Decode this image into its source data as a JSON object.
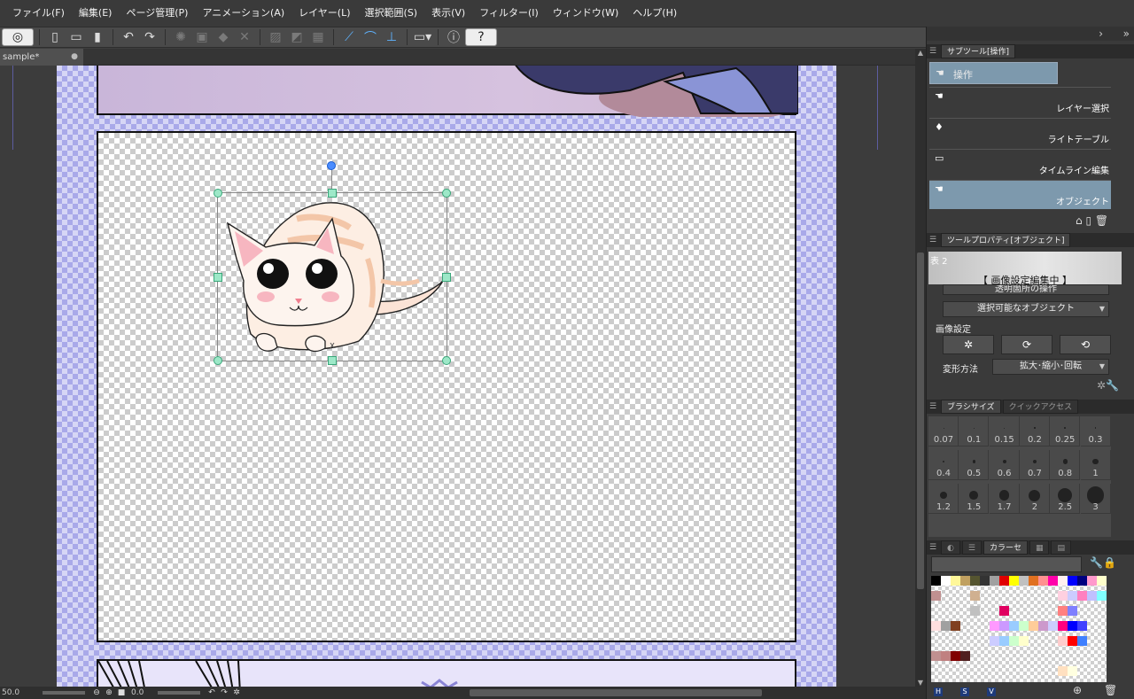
{
  "menu": [
    "ファイル(F)",
    "編集(E)",
    "ページ管理(P)",
    "アニメーション(A)",
    "レイヤー(L)",
    "選択範囲(S)",
    "表示(V)",
    "フィルター(I)",
    "ウィンドウ(W)",
    "ヘルプ(H)"
  ],
  "document": {
    "tab_title": "sample*"
  },
  "status": {
    "zoom": "50.0",
    "angle": "0.0"
  },
  "subtool_panel": {
    "title": "サブツール[操作]",
    "group_label": "操作",
    "items": [
      {
        "label": "レイヤー選択"
      },
      {
        "label": "ライトテーブル"
      },
      {
        "label": "タイムライン編集"
      },
      {
        "label": "オブジェクト"
      }
    ]
  },
  "tool_property_panel": {
    "title": "ツールプロパティ[オブジェクト]",
    "preview_name": "表 2",
    "preview_status": "【 画像設定編集中 】",
    "transparent_op": "透明箇所の操作",
    "selectable_object": "選択可能なオブジェクト",
    "image_settings_label": "画像設定",
    "transform_label": "変形方法",
    "transform_value": "拡大･縮小･回転"
  },
  "brush_panel": {
    "tabs": [
      "ブラシサイズ",
      "クイックアクセス"
    ],
    "sizes": [
      "0.07",
      "0.1",
      "0.15",
      "0.2",
      "0.25",
      "0.3",
      "0.4",
      "0.5",
      "0.6",
      "0.7",
      "0.8",
      "1",
      "1.2",
      "1.5",
      "1.7",
      "2",
      "2.5",
      "3"
    ]
  },
  "color_panel": {
    "tab_label": "カラーセ",
    "footer": [
      "H",
      "S",
      "V"
    ],
    "swatch_rows": [
      [
        "#000000",
        "#ffffff",
        "#fff799",
        "#c0a060",
        "#555530",
        "#333333",
        "#a0a0a0",
        "#e00000",
        "#ffff00",
        "#c0c0c0",
        "#e07020",
        "#ff9090",
        "#ff00aa",
        "#fff0f0",
        "#0000ff",
        "#000080",
        "#ff99cc",
        "#ffffcc"
      ],
      [
        "#c09090",
        "",
        "",
        "",
        "#d0b090",
        "",
        "",
        "",
        "",
        "",
        "",
        "",
        "",
        "#ffd0e0",
        "#ccccff",
        "#ff80c0",
        "#c0c0ff",
        "#80ffff"
      ],
      [
        "",
        "",
        "",
        "",
        "#c0c0c0",
        "",
        "",
        "#e00060",
        "",
        "",
        "",
        "",
        "",
        "#ff8080",
        "#8080ff",
        "",
        "",
        ""
      ],
      [
        "#ffe0e0",
        "#a0a0a0",
        "#804020",
        "",
        "",
        "",
        "#ff99ff",
        "#cc99ff",
        "#99ccff",
        "#ccffcc",
        "#ffcc99",
        "#cc99cc",
        "#ccccff",
        "#ff0080",
        "#0000ff",
        "#4040ff",
        "",
        ""
      ],
      [
        "",
        "",
        "",
        "",
        "",
        "",
        "#ccccff",
        "#99ccff",
        "#ccffcc",
        "#ffffcc",
        "",
        "",
        "",
        "#ffcccc",
        "#ff0000",
        "#4080ff",
        "",
        ""
      ],
      [
        "#c09090",
        "#c08080",
        "#800000",
        "#502020",
        "",
        "",
        "",
        "",
        "",
        "",
        "",
        "",
        "",
        "",
        "",
        "",
        "",
        ""
      ],
      [
        "",
        "",
        "",
        "",
        "",
        "",
        "",
        "",
        "",
        "",
        "",
        "",
        "",
        "#ffe0c0",
        "#ffffe0",
        "",
        "",
        ""
      ]
    ]
  },
  "colors": {
    "selected_subtool": "#7d99ad",
    "page_border": "#a9a9e9",
    "handle": "#9de8c8",
    "rotate_handle": "#4a8cff"
  }
}
